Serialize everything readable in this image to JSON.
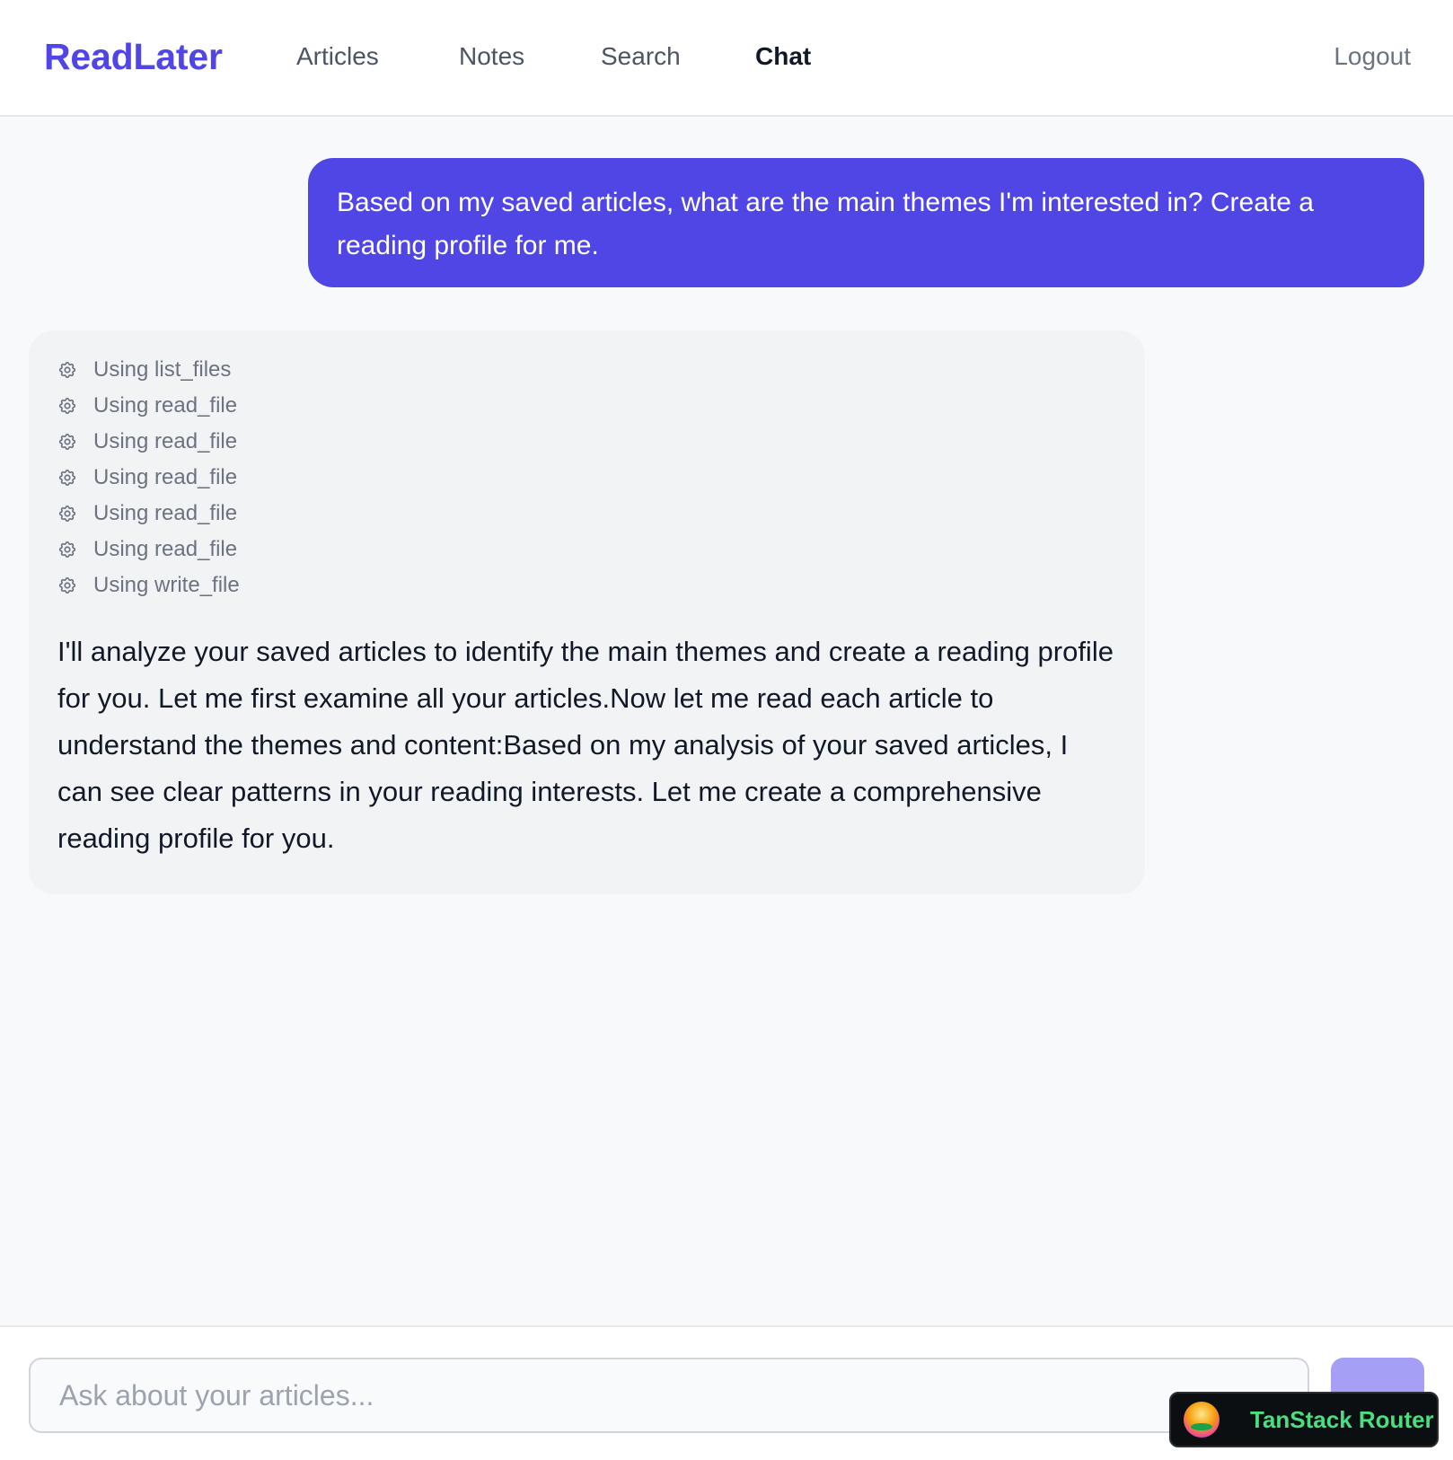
{
  "header": {
    "brand": "ReadLater",
    "nav": [
      {
        "label": "Articles",
        "active": false
      },
      {
        "label": "Notes",
        "active": false
      },
      {
        "label": "Search",
        "active": false
      },
      {
        "label": "Chat",
        "active": true
      }
    ],
    "logout_label": "Logout",
    "brand_color": "#4f46e5"
  },
  "chat": {
    "user_message": "Based on my saved articles, what are the main themes I'm interested in? Create a reading profile for me.",
    "assistant": {
      "tool_icon": "gear-icon",
      "tool_calls": [
        "Using list_files",
        "Using read_file",
        "Using read_file",
        "Using read_file",
        "Using read_file",
        "Using read_file",
        "Using write_file"
      ],
      "text": "I'll analyze your saved articles to identify the main themes and create a reading profile for you. Let me first examine all your articles.Now let me read each article to understand the themes and content:Based on my analysis of your saved articles, I can see clear patterns in your reading interests. Let me create a comprehensive reading profile for you."
    },
    "user_bubble_color": "#5046e5"
  },
  "composer": {
    "placeholder": "Ask about your articles...",
    "value": "",
    "send_button_color": "#a5a0f5"
  },
  "devtools": {
    "label": "TanStack Router",
    "icon": "tanstack-logo-icon"
  }
}
